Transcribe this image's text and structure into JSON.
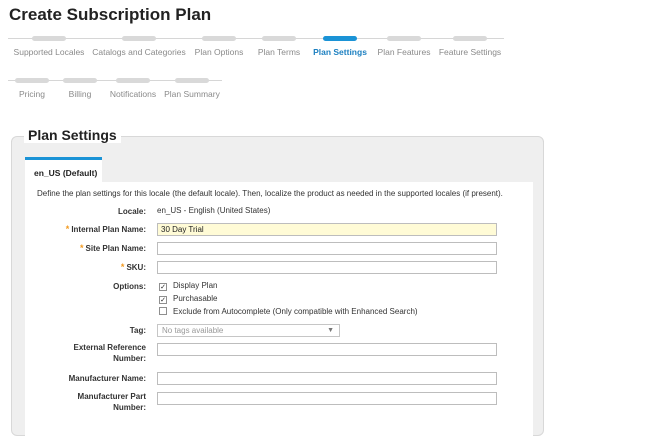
{
  "page": {
    "title": "Create Subscription Plan"
  },
  "wizard": {
    "row1": [
      {
        "label": "Supported Locales",
        "active": false
      },
      {
        "label": "Catalogs and Categories",
        "active": false
      },
      {
        "label": "Plan Options",
        "active": false
      },
      {
        "label": "Plan Terms",
        "active": false
      },
      {
        "label": "Plan Settings",
        "active": true
      },
      {
        "label": "Plan Features",
        "active": false
      },
      {
        "label": "Feature Settings",
        "active": false
      }
    ],
    "row2": [
      {
        "label": "Pricing",
        "active": false
      },
      {
        "label": "Billing",
        "active": false
      },
      {
        "label": "Notifications",
        "active": false
      },
      {
        "label": "Plan Summary",
        "active": false
      }
    ]
  },
  "panel": {
    "title": "Plan Settings",
    "tab_label": "en_US (Default)",
    "intro": "Define the plan settings for this locale (the default locale). Then, localize the product as needed in the supported locales (if present)."
  },
  "form": {
    "locale_label": "Locale:",
    "locale_value": "en_US - English (United States)",
    "internal_name_label": "Internal Plan Name:",
    "internal_name_value": "30 Day Trial",
    "site_name_label": "Site Plan Name:",
    "site_name_value": "",
    "sku_label": "SKU:",
    "sku_value": "",
    "options_label": "Options:",
    "options": [
      {
        "label": "Display Plan",
        "checked": true
      },
      {
        "label": "Purchasable",
        "checked": true
      },
      {
        "label": "Exclude from Autocomplete (Only compatible with Enhanced Search)",
        "checked": false
      }
    ],
    "tag_label": "Tag:",
    "tag_placeholder": "No tags available",
    "ext_ref_label_1": "External Reference",
    "ext_ref_label_2": "Number:",
    "ext_ref_value": "",
    "manufacturer_label": "Manufacturer Name:",
    "manufacturer_value": "",
    "mpn_label_1": "Manufacturer Part",
    "mpn_label_2": "Number:",
    "mpn_value": ""
  },
  "colors": {
    "accent": "#1b93d6",
    "required": "#f39a1f",
    "filled_input": "#fffbd6"
  }
}
